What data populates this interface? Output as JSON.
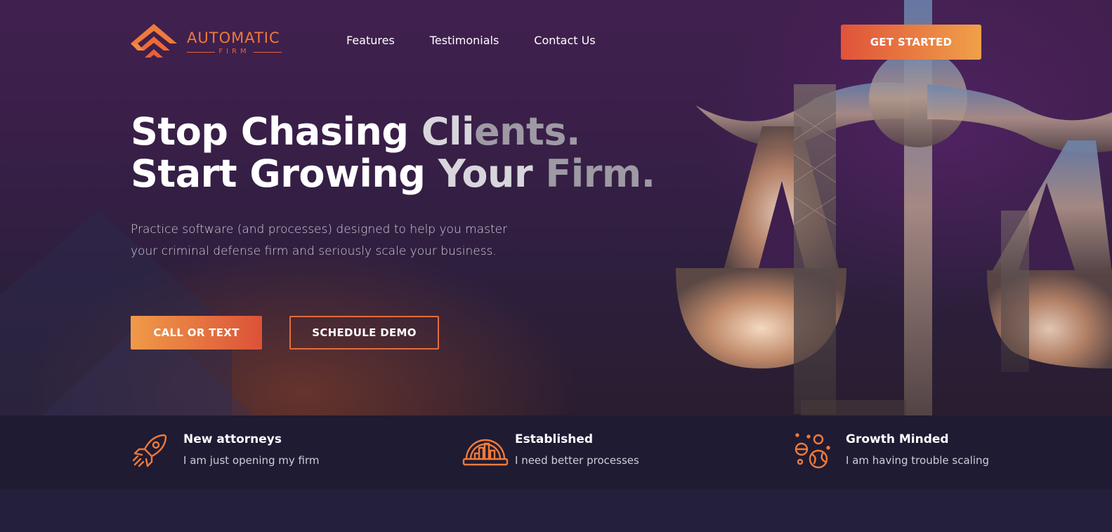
{
  "logo": {
    "word": "AUTOMATIC",
    "sub": "FIRM"
  },
  "nav": {
    "items": [
      "Features",
      "Testimonials",
      "Contact Us"
    ],
    "cta_label": "GET STARTED"
  },
  "hero": {
    "headline_line1_a": "Stop Chasing ",
    "headline_line1_b": "Cli",
    "headline_line1_c": "ents.",
    "headline_line2_a": "Start Growing ",
    "headline_line2_b": "Your ",
    "headline_line2_c": "Firm.",
    "subtext": "Practice software (and processes) designed to help you master your criminal defense firm and seriously scale your business.",
    "primary_button": "CALL OR TEXT",
    "secondary_button": "SCHEDULE DEMO",
    "background_image": "rocket launch through scales of justice"
  },
  "features": [
    {
      "title": "New attorneys",
      "desc": "I am just opening my firm",
      "icon": "rocket-icon"
    },
    {
      "title": "Established",
      "desc": "I need better processes",
      "icon": "building-dome-icon"
    },
    {
      "title": "Growth Minded",
      "desc": "I am having trouble scaling",
      "icon": "planets-icon"
    }
  ],
  "colors": {
    "accent_orange": "#e8603a",
    "accent_yellow": "#f0a04a",
    "hero_purple": "#3e1f4d",
    "strip_bg": "#1f1b33"
  }
}
